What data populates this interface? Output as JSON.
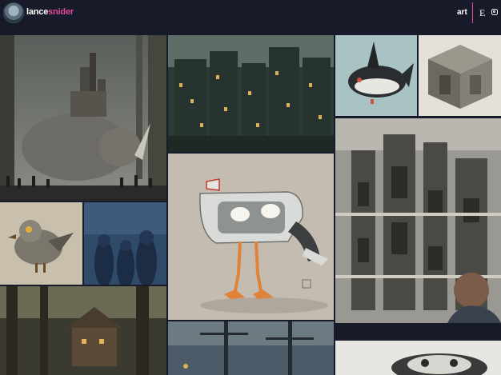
{
  "site": {
    "name_part1": "lance",
    "name_part2": "snider"
  },
  "nav": {
    "art_label": "art",
    "etsy_icon": "E",
    "instagram_icon": "instagram-icon"
  },
  "colors": {
    "background": "#161a29",
    "accent": "#e0489a"
  },
  "gallery": [
    {
      "id": "rhino-fortress",
      "subject": "giant rhino carrying a castle"
    },
    {
      "id": "night-city",
      "subject": "dense night town with lit windows"
    },
    {
      "id": "mechanical-orca",
      "subject": "mechanical killer whale"
    },
    {
      "id": "stone-cube",
      "subject": "carved stone cube"
    },
    {
      "id": "robot-bird",
      "subject": "steampunk bird"
    },
    {
      "id": "blue-figures",
      "subject": "hooded figures in blue"
    },
    {
      "id": "seagull-machine",
      "subject": "walking machine with seagulls"
    },
    {
      "id": "cathedral-drawing",
      "subject": "detailed cathedral drawing with artist"
    },
    {
      "id": "tree-house",
      "subject": "tree house village"
    },
    {
      "id": "ship-masts",
      "subject": "ship masts at dusk"
    },
    {
      "id": "skeleton",
      "subject": "skeleton creature"
    }
  ]
}
